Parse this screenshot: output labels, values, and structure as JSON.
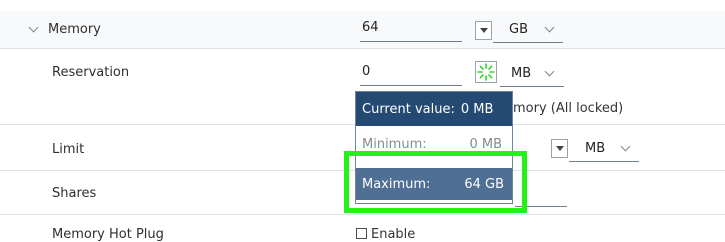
{
  "memory": {
    "label": "Memory",
    "value": "64",
    "unit": "GB"
  },
  "reservation": {
    "label": "Reservation",
    "value": "0",
    "unit": "MB",
    "note": "mory (All locked)"
  },
  "popup": {
    "current_label": "Current value:",
    "current_value": "0 MB",
    "minimum_label": "Minimum:",
    "minimum_value": "0 MB",
    "maximum_label": "Maximum:",
    "maximum_value": "64 GB"
  },
  "limit": {
    "label": "Limit",
    "unit": "MB"
  },
  "shares": {
    "label": "Shares"
  },
  "hot_plug": {
    "label": "Memory Hot Plug",
    "checkbox_label": "Enable",
    "checked": false
  },
  "colors": {
    "highlight": "#24f11a",
    "popup_current_bg": "#244a74",
    "popup_max_bg": "#4f6f95"
  },
  "icons": {
    "expander": "chevron-down-icon",
    "reservation_spinner": "loading-spinner-icon"
  }
}
